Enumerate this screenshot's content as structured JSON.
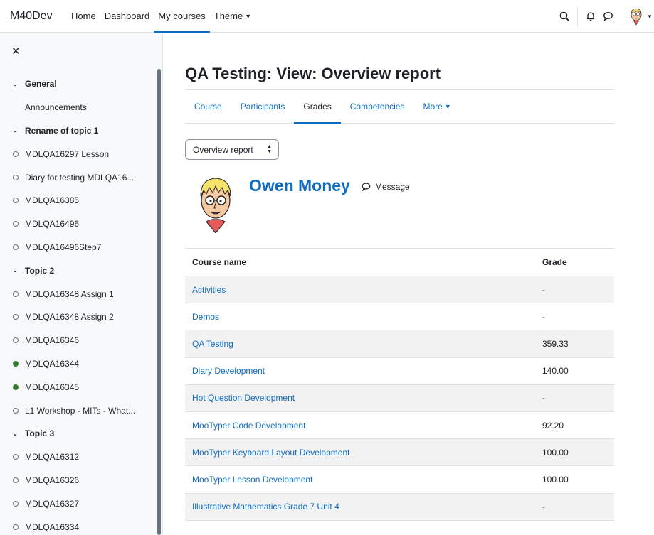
{
  "navbar": {
    "brand": "M40Dev",
    "items": [
      {
        "label": "Home"
      },
      {
        "label": "Dashboard"
      },
      {
        "label": "My courses"
      },
      {
        "label": "Theme"
      }
    ]
  },
  "drawer": {
    "items": [
      {
        "type": "section",
        "label": "General"
      },
      {
        "type": "plain",
        "label": "Announcements"
      },
      {
        "type": "section",
        "label": "Rename of topic 1"
      },
      {
        "type": "activity",
        "label": "MDLQA16297 Lesson",
        "done": false
      },
      {
        "type": "activity",
        "label": "Diary for testing MDLQA16...",
        "done": false
      },
      {
        "type": "activity",
        "label": "MDLQA16385",
        "done": false
      },
      {
        "type": "activity",
        "label": "MDLQA16496",
        "done": false
      },
      {
        "type": "activity",
        "label": "MDLQA16496Step7",
        "done": false
      },
      {
        "type": "section",
        "label": "Topic 2"
      },
      {
        "type": "activity",
        "label": "MDLQA16348 Assign 1",
        "done": false
      },
      {
        "type": "activity",
        "label": "MDLQA16348 Assign 2",
        "done": false
      },
      {
        "type": "activity",
        "label": "MDLQA16346",
        "done": false
      },
      {
        "type": "activity",
        "label": "MDLQA16344",
        "done": true
      },
      {
        "type": "activity",
        "label": "MDLQA16345",
        "done": true
      },
      {
        "type": "activity",
        "label": "L1 Workshop - MITs - What...",
        "done": false
      },
      {
        "type": "section",
        "label": "Topic 3"
      },
      {
        "type": "activity",
        "label": "MDLQA16312",
        "done": false
      },
      {
        "type": "activity",
        "label": "MDLQA16326",
        "done": false
      },
      {
        "type": "activity",
        "label": "MDLQA16327",
        "done": false
      },
      {
        "type": "activity",
        "label": "MDLQA16334",
        "done": false
      }
    ]
  },
  "page": {
    "title": "QA Testing: View: Overview report",
    "tabs": [
      {
        "label": "Course"
      },
      {
        "label": "Participants"
      },
      {
        "label": "Grades"
      },
      {
        "label": "Competencies"
      },
      {
        "label": "More"
      }
    ],
    "report_select": "Overview report",
    "user_name": "Owen Money",
    "message_label": "Message"
  },
  "grades_table": {
    "headers": [
      "Course name",
      "Grade"
    ],
    "rows": [
      {
        "course": "Activities",
        "grade": "-"
      },
      {
        "course": "Demos",
        "grade": "-"
      },
      {
        "course": "QA Testing",
        "grade": "359.33"
      },
      {
        "course": "Diary Development",
        "grade": "140.00"
      },
      {
        "course": "Hot Question Development",
        "grade": "-"
      },
      {
        "course": "MooTyper Code Development",
        "grade": "92.20"
      },
      {
        "course": "MooTyper Keyboard Layout Development",
        "grade": "100.00"
      },
      {
        "course": "MooTyper Lesson Development",
        "grade": "100.00"
      },
      {
        "course": "Illustrative Mathematics Grade 7 Unit 4",
        "grade": "-"
      }
    ]
  },
  "colors": {
    "link": "#0f6cbf",
    "completed": "#357a32"
  }
}
